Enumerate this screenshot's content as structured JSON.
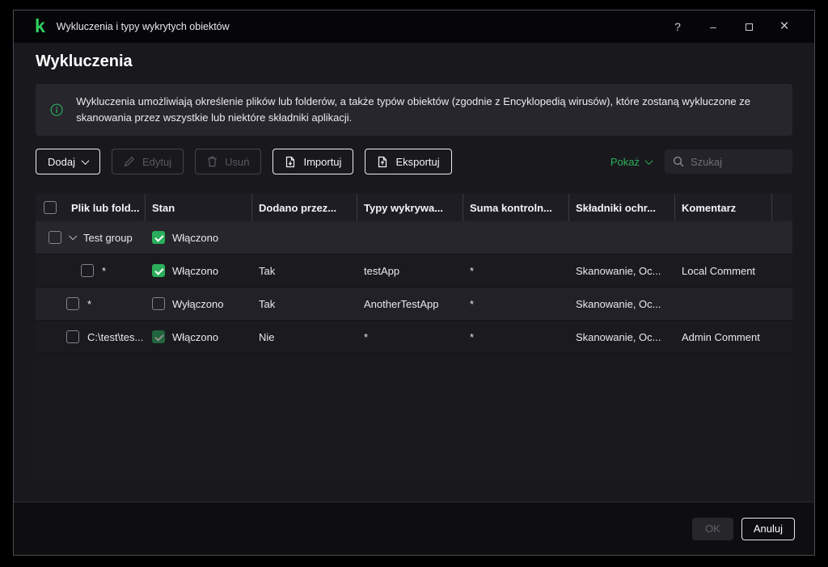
{
  "window": {
    "title": "Wykluczenia i typy wykrytych obiektów",
    "controls": {
      "help": "?",
      "minimize": "–",
      "close": "×"
    }
  },
  "page": {
    "title": "Wykluczenia",
    "info_banner": "Wykluczenia umożliwiają określenie plików lub folderów, a także typów obiektów (zgodnie z Encyklopedią wirusów), które zostaną wykluczone ze skanowania przez wszystkie lub niektóre składniki aplikacji."
  },
  "toolbar": {
    "add": "Dodaj",
    "edit": "Edytuj",
    "delete": "Usuń",
    "import": "Importuj",
    "export": "Eksportuj",
    "show": "Pokaż",
    "search_placeholder": "Szukaj"
  },
  "table": {
    "columns": [
      "Plik lub fold...",
      "Stan",
      "Dodano przez...",
      "Typy wykrywa...",
      "Suma kontroln...",
      "Składniki ochr...",
      "Komentarz"
    ],
    "group": {
      "name": "Test group",
      "state": "Włączono",
      "state_checked": true,
      "expanded": true
    },
    "rows": [
      {
        "path": "*",
        "state": "Włączono",
        "state_checked": true,
        "state_disabled": false,
        "added_by": "Tak",
        "types": "testApp",
        "checksum": "*",
        "components": "Skanowanie, Oc...",
        "comment": "Local Comment",
        "in_group": true
      },
      {
        "path": "*",
        "state": "Wyłączono",
        "state_checked": false,
        "state_disabled": false,
        "added_by": "Tak",
        "types": "AnotherTestApp",
        "checksum": "*",
        "components": "Skanowanie, Oc...",
        "comment": "",
        "in_group": false
      },
      {
        "path": "C:\\test\\tes...",
        "state": "Włączono",
        "state_checked": true,
        "state_disabled": true,
        "added_by": "Nie",
        "types": "*",
        "checksum": "*",
        "components": "Skanowanie, Oc...",
        "comment": "Admin Comment",
        "in_group": false
      }
    ]
  },
  "footer": {
    "ok": "OK",
    "cancel": "Anuluj"
  },
  "colors": {
    "accent_green": "#2BAE5B",
    "logo_green": "#2ED160",
    "window_bg": "#19191d",
    "titlebar_bg": "#060608"
  }
}
